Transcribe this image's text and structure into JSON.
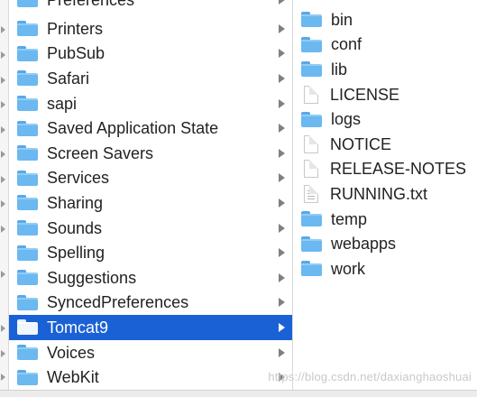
{
  "colors": {
    "selection": "#1b61d6",
    "folder": "#6cb8f0"
  },
  "middle_column": {
    "items": [
      {
        "label": "Preferences",
        "selected": false,
        "icon": "folder-icon"
      },
      {
        "label": "Printers",
        "selected": false,
        "icon": "folder-icon"
      },
      {
        "label": "PubSub",
        "selected": false,
        "icon": "folder-icon"
      },
      {
        "label": "Safari",
        "selected": false,
        "icon": "folder-icon"
      },
      {
        "label": "sapi",
        "selected": false,
        "icon": "folder-icon"
      },
      {
        "label": "Saved Application State",
        "selected": false,
        "icon": "folder-icon"
      },
      {
        "label": "Screen Savers",
        "selected": false,
        "icon": "folder-icon"
      },
      {
        "label": "Services",
        "selected": false,
        "icon": "folder-icon"
      },
      {
        "label": "Sharing",
        "selected": false,
        "icon": "folder-icon"
      },
      {
        "label": "Sounds",
        "selected": false,
        "icon": "folder-icon"
      },
      {
        "label": "Spelling",
        "selected": false,
        "icon": "folder-icon"
      },
      {
        "label": "Suggestions",
        "selected": false,
        "icon": "folder-icon"
      },
      {
        "label": "SyncedPreferences",
        "selected": false,
        "icon": "folder-icon"
      },
      {
        "label": "Tomcat9",
        "selected": true,
        "icon": "folder-icon"
      },
      {
        "label": "Voices",
        "selected": false,
        "icon": "folder-icon"
      },
      {
        "label": "WebKit",
        "selected": false,
        "icon": "folder-icon"
      }
    ]
  },
  "right_column": {
    "items": [
      {
        "label": "bin",
        "icon": "folder-icon"
      },
      {
        "label": "conf",
        "icon": "folder-icon"
      },
      {
        "label": "lib",
        "icon": "folder-icon"
      },
      {
        "label": "LICENSE",
        "icon": "document-icon"
      },
      {
        "label": "logs",
        "icon": "folder-icon"
      },
      {
        "label": "NOTICE",
        "icon": "document-icon"
      },
      {
        "label": "RELEASE-NOTES",
        "icon": "document-icon"
      },
      {
        "label": "RUNNING.txt",
        "icon": "text-file-icon"
      },
      {
        "label": "temp",
        "icon": "folder-icon"
      },
      {
        "label": "webapps",
        "icon": "folder-icon"
      },
      {
        "label": "work",
        "icon": "folder-icon"
      }
    ]
  },
  "watermark": "https://blog.csdn.net/daxianghaoshuai"
}
